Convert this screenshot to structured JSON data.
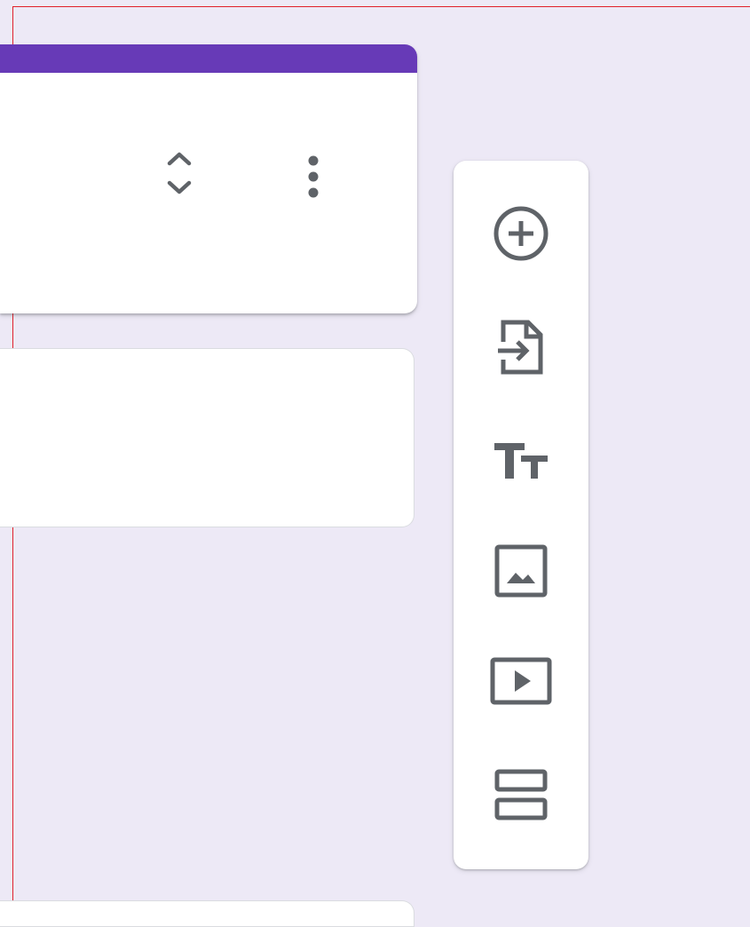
{
  "theme": {
    "accent": "#673ab7",
    "background": "#ede9f6",
    "card": "#ffffff",
    "icon_color": "#5f6368",
    "frame_line": "#e0202a"
  },
  "title_card": {
    "icons": [
      "expand-collapse-icon",
      "more-vert-icon"
    ]
  },
  "floating_toolbar": {
    "items": [
      {
        "icon": "add-circle-icon",
        "action": "add-question"
      },
      {
        "icon": "import-file-icon",
        "action": "import-questions"
      },
      {
        "icon": "title-text-icon",
        "action": "add-title-and-description"
      },
      {
        "icon": "image-icon",
        "action": "add-image"
      },
      {
        "icon": "video-icon",
        "action": "add-video"
      },
      {
        "icon": "section-icon",
        "action": "add-section"
      }
    ]
  }
}
